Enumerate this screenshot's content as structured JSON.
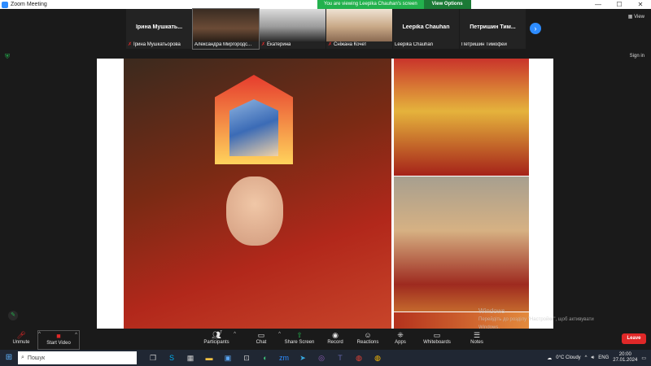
{
  "window": {
    "title": "Zoom Meeting",
    "controls": [
      "—",
      "☐",
      "✕"
    ]
  },
  "share_banner": {
    "message": "You are viewing Leepika Chauhan's screen",
    "options_label": "View Options"
  },
  "gallery": [
    {
      "big_name": "Ірина  Мушкать...",
      "label": "Ірина Мушкатьорова",
      "muted": true,
      "has_video": false
    },
    {
      "big_name": "",
      "label": "Александра Миргородс...",
      "muted": false,
      "has_video": true,
      "active": true
    },
    {
      "big_name": "",
      "label": "Екатерина",
      "muted": true,
      "has_video": true
    },
    {
      "big_name": "",
      "label": "Сніжана Кочет",
      "muted": true,
      "has_video": true
    },
    {
      "big_name": "Leepika Chauhan",
      "label": "Leepika Chauhan",
      "muted": false,
      "has_video": false
    },
    {
      "big_name": "Петришин  Тим...",
      "label": "Петришин Тимофей",
      "muted": false,
      "has_video": false
    }
  ],
  "view_label": "View",
  "sign_in_label": "Sign in",
  "watermark": {
    "line1": "Windows",
    "line2": "Перейдіть до розділу \"Настройки\", щоб активувати",
    "line3": "Windows."
  },
  "toolbar": {
    "unmute": "Unmute",
    "start_video": "Start Video",
    "participants": "Participants",
    "participants_count": "7",
    "chat": "Chat",
    "share_screen": "Share Screen",
    "record": "Record",
    "reactions": "Reactions",
    "apps": "Apps",
    "whiteboards": "Whiteboards",
    "notes": "Notes",
    "leave": "Leave"
  },
  "taskbar": {
    "search_placeholder": "Пошук",
    "weather": "0°C  Cloudy",
    "language": "ENG",
    "time": "20:00",
    "date": "27.01.2024"
  },
  "colors": {
    "zoom_blue": "#2d8cff",
    "share_green": "#23b14d",
    "leave_red": "#e02828"
  }
}
